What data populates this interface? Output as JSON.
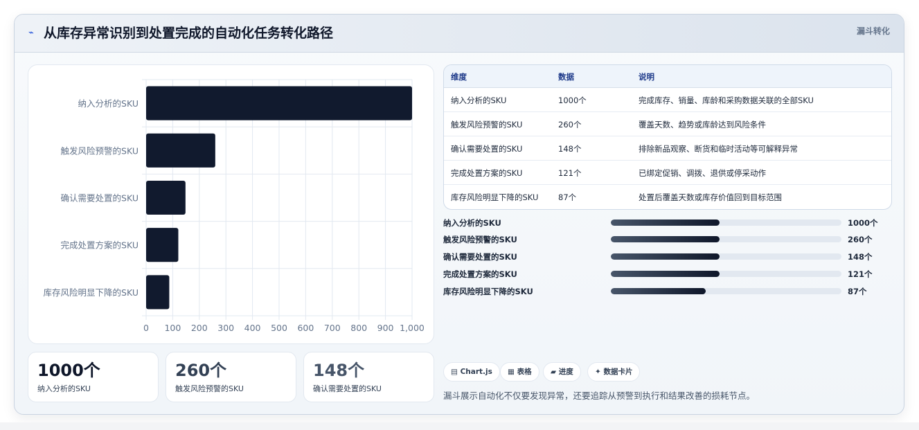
{
  "header": {
    "icon": "trend-icon",
    "title": "从库存异常识别到处置完成的自动化任务转化路径",
    "tag": "漏斗转化"
  },
  "colors": {
    "bar": "#111a2e",
    "grid": "#e2e8f0",
    "axis_text": "#64748b",
    "kpi_1": "#0f172a",
    "kpi_2": "#334155",
    "kpi_3": "#475569"
  },
  "chart_data": {
    "type": "bar",
    "orientation": "horizontal",
    "categories": [
      "纳入分析的SKU",
      "触发风险预警的SKU",
      "确认需要处置的SKU",
      "完成处置方案的SKU",
      "库存风险明显下降的SKU"
    ],
    "values": [
      1000,
      260,
      148,
      121,
      87
    ],
    "xlim": [
      0,
      1000
    ],
    "xticks": [
      0,
      100,
      200,
      300,
      400,
      500,
      600,
      700,
      800,
      900,
      1000
    ],
    "xtick_labels": [
      "0",
      "100",
      "200",
      "300",
      "400",
      "500",
      "600",
      "700",
      "800",
      "900",
      "1,000"
    ],
    "grid": true,
    "legend": "none"
  },
  "kpis": [
    {
      "value": "1000个",
      "label": "纳入分析的SKU"
    },
    {
      "value": "260个",
      "label": "触发风险预警的SKU"
    },
    {
      "value": "148个",
      "label": "确认需要处置的SKU"
    }
  ],
  "table": {
    "headers": [
      "维度",
      "数据",
      "说明"
    ],
    "rows": [
      [
        "纳入分析的SKU",
        "1000个",
        "完成库存、销量、库龄和采购数据关联的全部SKU"
      ],
      [
        "触发风险预警的SKU",
        "260个",
        "覆盖天数、趋势或库龄达到风险条件"
      ],
      [
        "确认需要处置的SKU",
        "148个",
        "排除新品观察、断货和临时活动等可解释异常"
      ],
      [
        "完成处置方案的SKU",
        "121个",
        "已绑定促销、调拨、退供或停采动作"
      ],
      [
        "库存风险明显下降的SKU",
        "87个",
        "处置后覆盖天数或库存价值回到目标范围"
      ]
    ]
  },
  "progress": [
    {
      "label": "纳入分析的SKU",
      "value": "1000个",
      "fill": 0.47
    },
    {
      "label": "触发风险预警的SKU",
      "value": "260个",
      "fill": 0.47
    },
    {
      "label": "确认需要处置的SKU",
      "value": "148个",
      "fill": 0.47
    },
    {
      "label": "完成处置方案的SKU",
      "value": "121个",
      "fill": 0.47
    },
    {
      "label": "库存风险明显下降的SKU",
      "value": "87个",
      "fill": 0.41
    }
  ],
  "chips": [
    {
      "icon": "chart-icon",
      "glyph": "▤",
      "label": "Chart.js"
    },
    {
      "icon": "table-icon",
      "glyph": "▦",
      "label": "表格"
    },
    {
      "icon": "progress-icon",
      "glyph": "▰",
      "label": "进度"
    },
    {
      "icon": "sparkle-icon",
      "glyph": "✦",
      "label": "数据卡片"
    }
  ],
  "note": "漏斗展示自动化不仅要发现异常，还要追踪从预警到执行和结果改善的损耗节点。"
}
